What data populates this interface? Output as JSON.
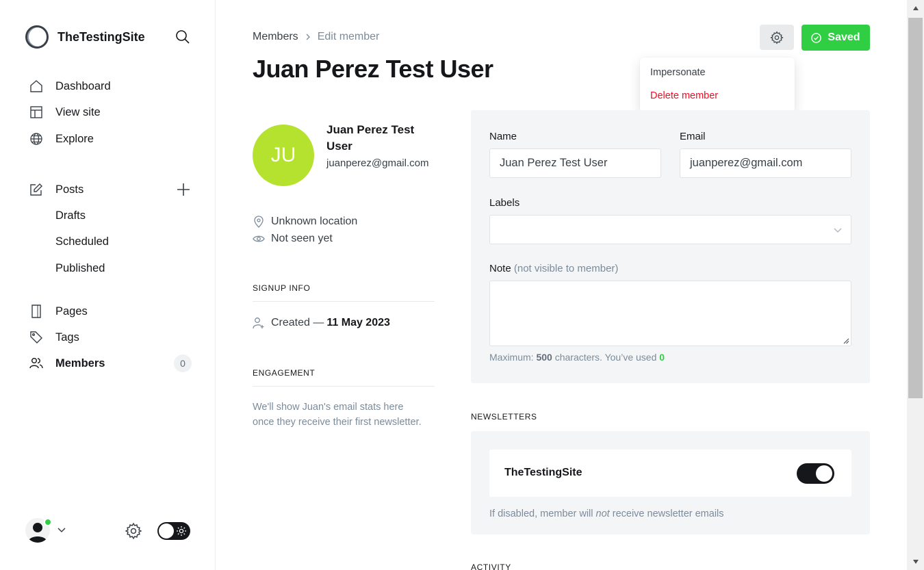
{
  "sidebar": {
    "site_name": "TheTestingSite",
    "nav": [
      {
        "label": "Dashboard",
        "icon": "home-icon"
      },
      {
        "label": "View site",
        "icon": "layout-icon"
      },
      {
        "label": "Explore",
        "icon": "globe-icon"
      }
    ],
    "posts": {
      "label": "Posts",
      "sub": [
        "Drafts",
        "Scheduled",
        "Published"
      ]
    },
    "pages_label": "Pages",
    "tags_label": "Tags",
    "members_label": "Members",
    "members_count": "0"
  },
  "header": {
    "breadcrumb_parent": "Members",
    "breadcrumb_current": "Edit member",
    "title": "Juan Perez Test User",
    "saved_label": "Saved",
    "saved_color": "#30cf43"
  },
  "actions_menu": {
    "impersonate": "Impersonate",
    "delete": "Delete member"
  },
  "member": {
    "initials": "JU",
    "name": "Juan Perez Test User",
    "email": "juanperez@gmail.com",
    "location": "Unknown location",
    "seen": "Not seen yet",
    "avatar_color": "#b5e22e"
  },
  "signup": {
    "heading": "SIGNUP INFO",
    "created_prefix": "Created —",
    "created_date": "11 May 2023"
  },
  "engagement": {
    "heading": "ENGAGEMENT",
    "text": "We'll show Juan's email stats here once they receive their first newsletter."
  },
  "form": {
    "name_label": "Name",
    "name_value": "Juan Perez Test User",
    "email_label": "Email",
    "email_value": "juanperez@gmail.com",
    "labels_label": "Labels",
    "note_label": "Note",
    "note_muted": "(not visible to member)",
    "hint_prefix": "Maximum:",
    "hint_max": "500",
    "hint_mid": "characters. You’ve used",
    "hint_used": "0"
  },
  "newsletters": {
    "heading": "NEWSLETTERS",
    "name": "TheTestingSite",
    "enabled": true,
    "hint_a": "If disabled, member will",
    "hint_not": "not",
    "hint_b": "receive newsletter emails"
  },
  "activity": {
    "heading": "ACTIVITY"
  }
}
